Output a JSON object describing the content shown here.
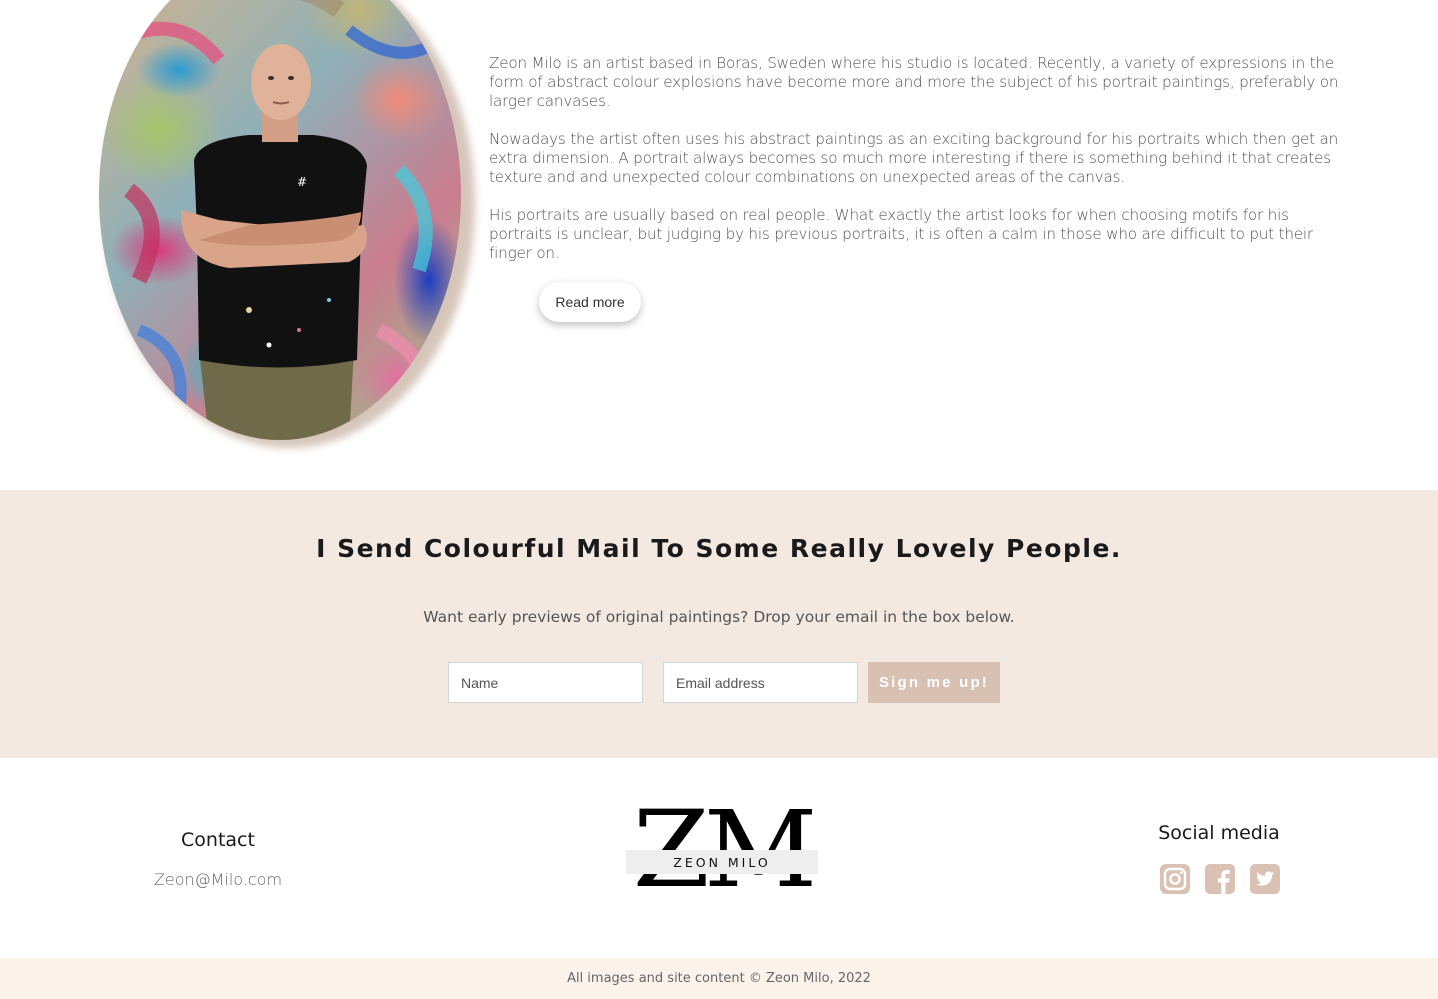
{
  "about": {
    "paragraphs": [
      "Zeon Milo is an artist based in Boras, Sweden where his studio is located. Recently, a variety of expressions in the form of abstract colour explosions have become more and more the subject of his portrait paintings, preferably on larger canvases.",
      "Nowadays the artist often uses his abstract paintings as an exciting background for his portraits which then get an extra dimension. A portrait always becomes so much more interesting if there is something behind it that creates texture and and unexpected colour combinations on unexpected areas of the canvas.",
      "His portraits are usually based on real people. What exactly the artist looks for when choosing motifs for his portraits is unclear, but judging by his previous portraits, it is often a calm in those who are difficult to put their finger on."
    ],
    "read_more_label": "Read more"
  },
  "newsletter": {
    "title": "I Send Colourful Mail To Some Really Lovely People.",
    "subtitle": "Want early previews of original paintings? Drop your email in the box below.",
    "name_placeholder": "Name",
    "email_placeholder": "Email address",
    "submit_label": "Sign me up!"
  },
  "footer": {
    "contact_title": "Contact",
    "contact_email": "Zeon@Milo.com",
    "logo_letters": "ZM",
    "logo_name": "ZEON MILO",
    "social_title": "Social media",
    "social_icons": [
      "instagram-icon",
      "facebook-icon",
      "twitter-icon"
    ],
    "copyright": "All images and site content © Zeon Milo, 2022"
  },
  "colors": {
    "newsletter_bg": "#f4e9e0",
    "button_accent": "#d8c0b2",
    "social_icon": "#d9c2b4",
    "copyright_bg": "#fbf3ea"
  }
}
